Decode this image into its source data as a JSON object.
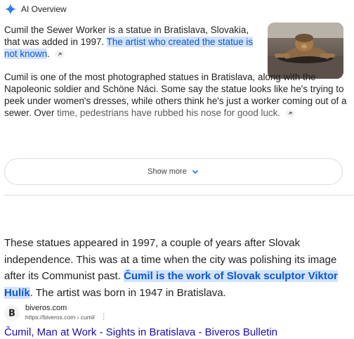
{
  "ai_overview": {
    "title": "AI Overview",
    "para1_plain": "Cumil the Sewer Worker is a statue in Bratislava, Slovakia, that was added in 1997. ",
    "para1_highlight": "The artist who created the statue is not known",
    "para1_end": ".",
    "para2": "Cumil is one of the most photographed statues in Bratislava, along with the Napoleonic soldier and Schöne Náci. Some say the statue looks like he's trying to peek under women's dresses, while others think he's just a worker coming out of a sewer. Over ",
    "para2_faded": "time, pedestrians have rubbed his nose for good luck.",
    "show_more_label": "Show more",
    "colors": {
      "accent": "#0b57d0",
      "highlight_bg": "#d3e3fd"
    },
    "icons": {
      "header": "ai-spark-icon",
      "link": "link-icon",
      "expand": "chevron-down-icon"
    }
  },
  "snippet": {
    "text_start": "These statues appeared in 1997, a couple of years after Slovak independence. This was at a time when the city was polishing its image after its Communist past. ",
    "text_bold_highlight": "Čumil is the work of Slovak sculptor Viktor Hulík",
    "text_end": ". The artist was born in 1947 in Bratislava."
  },
  "result": {
    "site_name": "biveros.com",
    "url": "https://biveros.com › cumil",
    "favicon_letter": "B",
    "title": "Čumil, Man at Work - Sights in Bratislava - Biveros Bulletin",
    "link_color": "#1a0dab"
  }
}
